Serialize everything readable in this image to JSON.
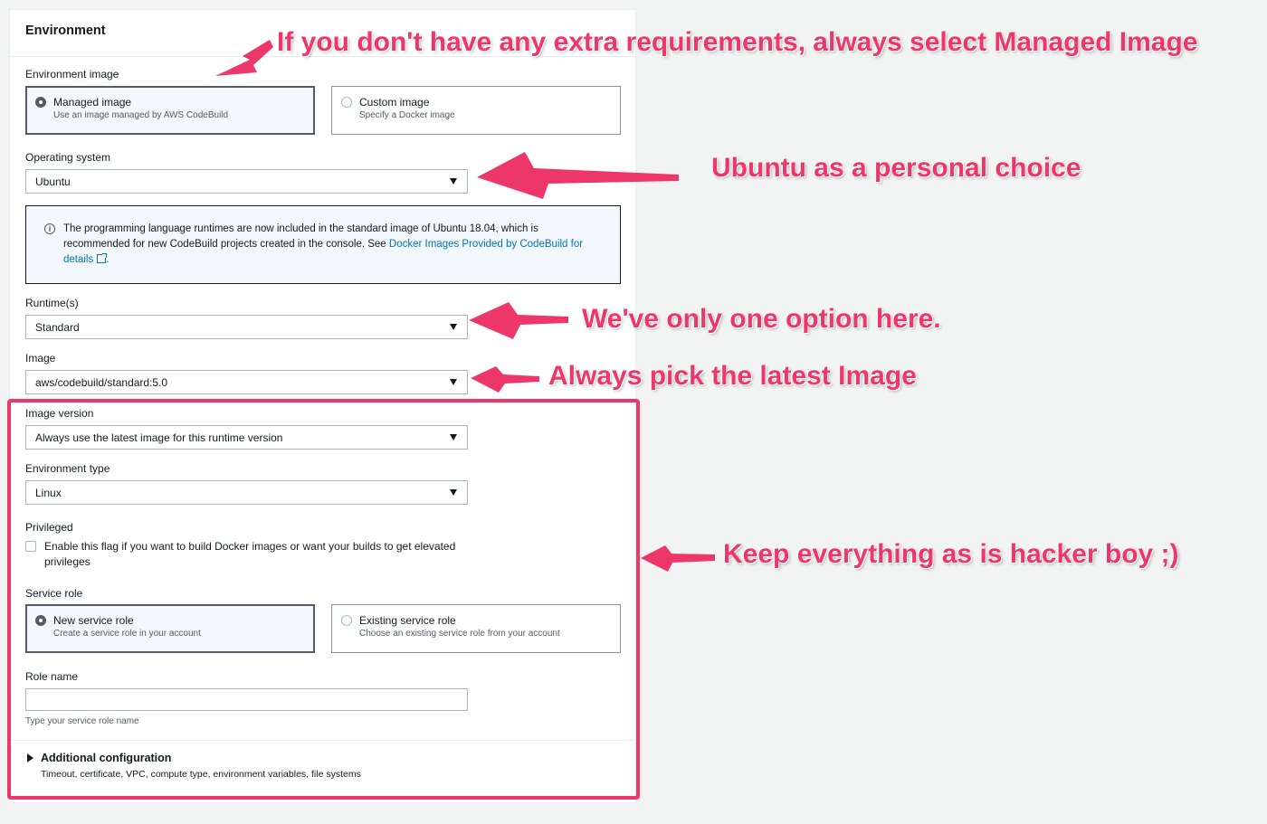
{
  "panel": {
    "title": "Environment",
    "environment_image": {
      "label": "Environment image",
      "options": [
        {
          "title": "Managed image",
          "description": "Use an image managed by AWS CodeBuild",
          "selected": true
        },
        {
          "title": "Custom image",
          "description": "Specify a Docker image",
          "selected": false
        }
      ]
    },
    "operating_system": {
      "label": "Operating system",
      "value": "Ubuntu"
    },
    "info_alert": {
      "text": "The programming language runtimes are now included in the standard image of Ubuntu 18.04, which is recommended for new CodeBuild projects created in the console. See ",
      "link": "Docker Images Provided by CodeBuild",
      "link_tail": "for details",
      "period": "."
    },
    "runtimes": {
      "label": "Runtime(s)",
      "value": "Standard"
    },
    "image": {
      "label": "Image",
      "value": "aws/codebuild/standard:5.0"
    },
    "image_version": {
      "label": "Image version",
      "value": "Always use the latest image for this runtime version"
    },
    "environment_type": {
      "label": "Environment type",
      "value": "Linux"
    },
    "privileged": {
      "label": "Privileged",
      "checkbox_text": "Enable this flag if you want to build Docker images or want your builds to get elevated privileges",
      "checked": false
    },
    "service_role": {
      "label": "Service role",
      "options": [
        {
          "title": "New service role",
          "description": "Create a service role in your account",
          "selected": true
        },
        {
          "title": "Existing service role",
          "description": "Choose an existing service role from your account",
          "selected": false
        }
      ]
    },
    "role_name": {
      "label": "Role name",
      "value": "",
      "hint": "Type your service role name"
    },
    "additional_config": {
      "title": "Additional configuration",
      "description": "Timeout, certificate, VPC, compute type, environment variables, file systems"
    }
  },
  "annotations": {
    "managed_image": "If you don't have any extra requirements, always select Managed Image",
    "ubuntu": "Ubuntu as a personal choice",
    "runtime": "We've only one option here.",
    "image": "Always pick the latest Image",
    "keep": "Keep everything as is hacker boy ;)"
  },
  "colors": {
    "annotation": "#ee3769",
    "link": "#0073bb",
    "selected_tile_bg": "#f2f8fd",
    "page_bg": "#f2f3f3"
  }
}
